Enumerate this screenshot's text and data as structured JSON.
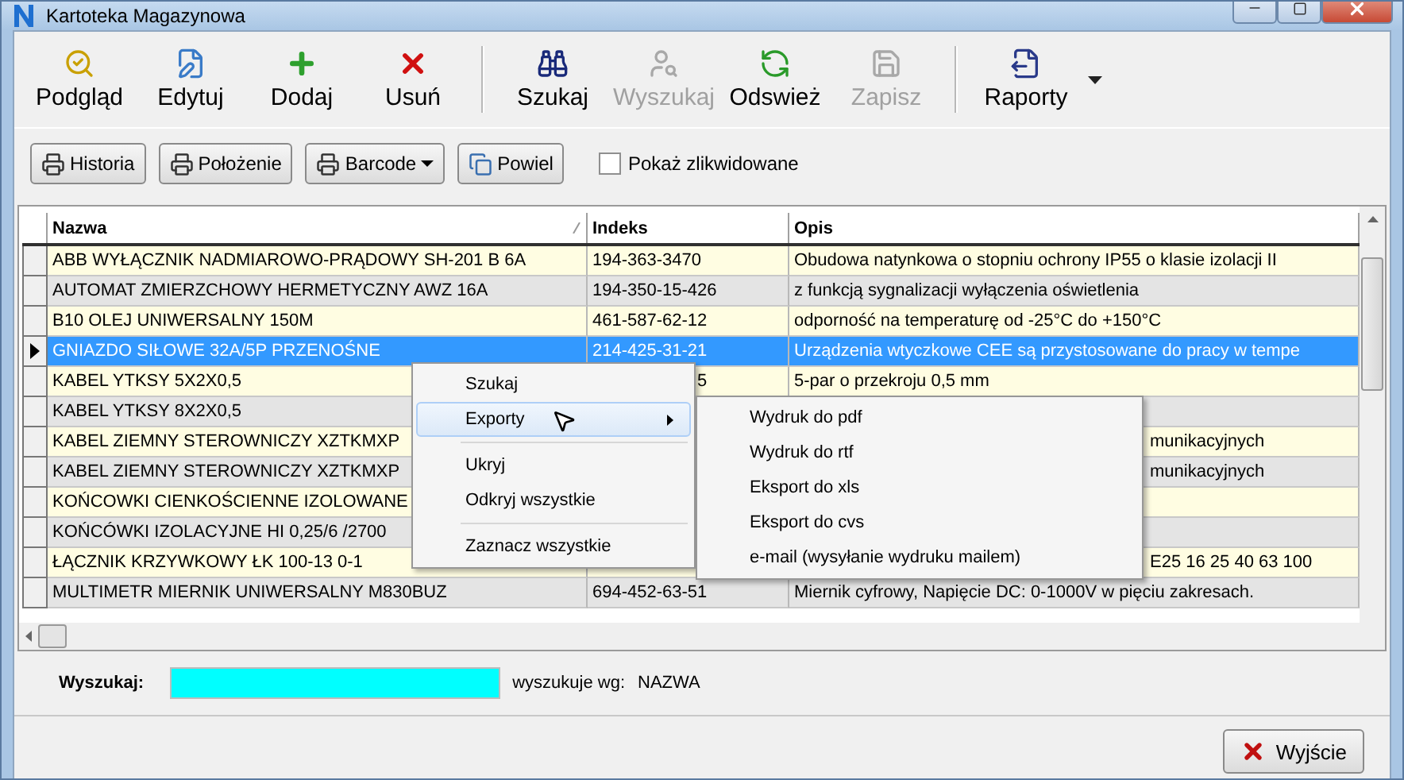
{
  "window": {
    "title": "Kartoteka Magazynowa"
  },
  "toolbar": [
    {
      "label": "Podgląd",
      "disabled": false
    },
    {
      "label": "Edytuj",
      "disabled": false
    },
    {
      "label": "Dodaj",
      "disabled": false
    },
    {
      "label": "Usuń",
      "disabled": false
    },
    {
      "label": "Szukaj",
      "disabled": false
    },
    {
      "label": "Wyszukaj",
      "disabled": true
    },
    {
      "label": "Odswież",
      "disabled": false
    },
    {
      "label": "Zapisz",
      "disabled": true
    },
    {
      "label": "Raporty",
      "disabled": false
    }
  ],
  "actions": [
    {
      "label": "Historia",
      "dropdown": false
    },
    {
      "label": "Położenie",
      "dropdown": false
    },
    {
      "label": "Barcode",
      "dropdown": true
    },
    {
      "label": "Powiel",
      "dropdown": false
    }
  ],
  "show_liquidated": {
    "label": "Pokaż zlikwidowane",
    "checked": false
  },
  "table": {
    "columns": [
      "Nazwa",
      "Indeks",
      "Opis"
    ],
    "rows": [
      {
        "cells": [
          "ABB WYŁĄCZNIK NADMIAROWO-PRĄDOWY SH-201 B 6A",
          "194-363-3470",
          "Obudowa natynkowa o stopniu ochrony IP55 o klasie izolacji II"
        ],
        "selected": false
      },
      {
        "cells": [
          "AUTOMAT ZMIERZCHOWY HERMETYCZNY AWZ 16A",
          "194-350-15-426",
          "z funkcją sygnalizacji wyłączenia oświetlenia"
        ],
        "selected": false
      },
      {
        "cells": [
          "B10 OLEJ UNIWERSALNY 150M",
          "461-587-62-12",
          "odporność na temperaturę od -25°C do +150°C"
        ],
        "selected": false
      },
      {
        "cells": [
          "GNIAZDO SIŁOWE 32A/5P PRZENOŚNE",
          "214-425-31-21",
          "Urządzenia wtyczkowe CEE są przystosowane do pracy w tempe"
        ],
        "selected": true
      },
      {
        "cells": [
          "KABEL YTKSY 5X2X0,5",
          "5",
          "5-par o przekroju 0,5 mm"
        ],
        "selected": false
      },
      {
        "cells": [
          "KABEL YTKSY 8X2X0,5",
          null,
          null
        ],
        "selected": false
      },
      {
        "cells": [
          "KABEL ZIEMNY STEROWNICZY XZTKMXP",
          null,
          "munikacyjnych"
        ],
        "selected": false
      },
      {
        "cells": [
          "KABEL ZIEMNY STEROWNICZY XZTKMXP",
          null,
          "munikacyjnych"
        ],
        "selected": false
      },
      {
        "cells": [
          "KOŃCOWKI CIENKOŚCIENNE IZOLOWANE",
          null,
          null
        ],
        "selected": false
      },
      {
        "cells": [
          "KOŃCÓWKI IZOLACYJNE HI 0,25/6 /2700",
          null,
          null
        ],
        "selected": false
      },
      {
        "cells": [
          "ŁĄCZNIK KRZYWKOWY ŁK 100-13 0-1",
          null,
          "E25 16 25 40 63 100"
        ],
        "selected": false
      },
      {
        "cells": [
          "MULTIMETR MIERNIK UNIWERSALNY M830BUZ",
          "694-452-63-51",
          "Miernik cyfrowy, Napięcie DC: 0-1000V w pięciu zakresach."
        ],
        "selected": false
      }
    ]
  },
  "context_menu": [
    {
      "kind": "item",
      "label": "Szukaj",
      "highlighted": false,
      "submenu": false
    },
    {
      "kind": "item",
      "label": "Exporty",
      "highlighted": true,
      "submenu": true
    },
    {
      "kind": "separator"
    },
    {
      "kind": "item",
      "label": "Ukryj",
      "highlighted": false,
      "submenu": false
    },
    {
      "kind": "item",
      "label": "Odkryj wszystkie",
      "highlighted": false,
      "submenu": false
    },
    {
      "kind": "separator"
    },
    {
      "kind": "item",
      "label": "Zaznacz wszystkie",
      "highlighted": false,
      "submenu": false
    }
  ],
  "submenu": [
    "Wydruk do pdf",
    "Wydruk do rtf",
    "Eksport do xls",
    "Eksport do cvs",
    "e-mail (wysyłanie wydruku mailem)"
  ],
  "search": {
    "label": "Wyszukaj:",
    "by_label": "wyszukuje wg:",
    "by_value": "NAZWA"
  },
  "exit_button": {
    "label": "Wyjście"
  }
}
